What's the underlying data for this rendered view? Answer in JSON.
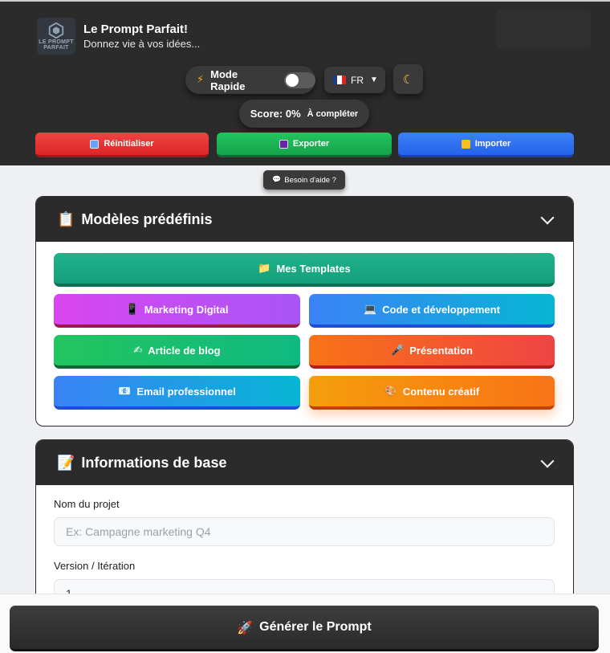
{
  "header": {
    "logo_text": "LE PROMPT PARFAIT",
    "title": "Le Prompt Parfait!",
    "subtitle": "Donnez vie à vos idées...",
    "mode_label": "Mode Rapide",
    "mode_on": false,
    "language": "FR",
    "score_label": "Score: 0%",
    "score_status": "À compléter",
    "reset_label": "Réinitialiser",
    "export_label": "Exporter",
    "import_label": "Importer",
    "help_label": "Besoin d'aide ?"
  },
  "templates_card": {
    "title": "Modèles prédéfinis",
    "items": [
      {
        "label": "Mes Templates"
      },
      {
        "label": "Marketing Digital"
      },
      {
        "label": "Code et développement"
      },
      {
        "label": "Article de blog"
      },
      {
        "label": "Présentation"
      },
      {
        "label": "Email professionnel"
      },
      {
        "label": "Contenu créatif"
      }
    ]
  },
  "basic_card": {
    "title": "Informations de base",
    "project_label": "Nom du projet",
    "project_placeholder": "Ex: Campagne marketing Q4",
    "project_value": "",
    "version_label": "Version / Itération",
    "version_value": "1"
  },
  "generate_label": "Générer le Prompt",
  "colors": {
    "header_bg": "#2b2b2b",
    "page_bg": "#eef0f3",
    "reset": "#ef4444",
    "export": "#22c55e",
    "import": "#3b82f6"
  }
}
